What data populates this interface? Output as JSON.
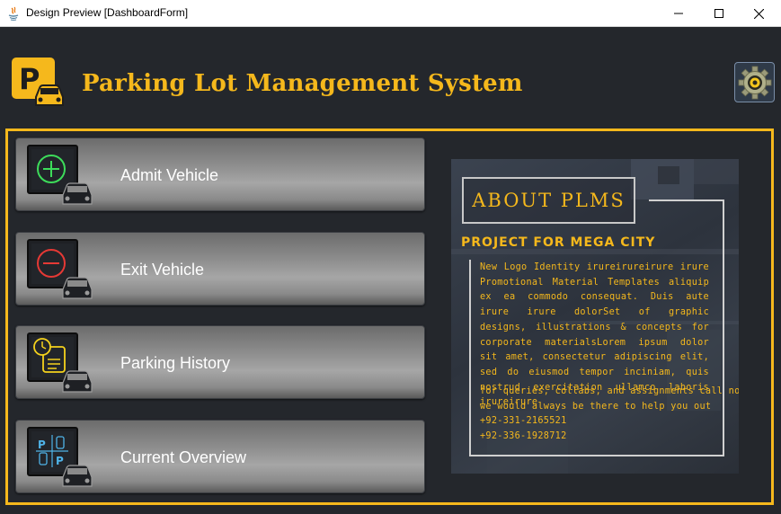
{
  "window": {
    "title": "Design Preview [DashboardForm]",
    "controls": [
      "minimize",
      "maximize",
      "close"
    ]
  },
  "header": {
    "logo_letter": "P",
    "title": "Parking Lot Management System",
    "settings_icon": "gear-icon"
  },
  "menu": [
    {
      "label": "Admit Vehicle",
      "icon": "admit-vehicle-icon"
    },
    {
      "label": "Exit Vehicle",
      "icon": "exit-vehicle-icon"
    },
    {
      "label": "Parking History",
      "icon": "parking-history-icon"
    },
    {
      "label": "Current Overview",
      "icon": "current-overview-icon"
    }
  ],
  "about": {
    "heading": "ABOUT PLMS",
    "subheading": "PROJECT FOR MEGA CITY",
    "body": "New Logo Identity irureirureirure irure Promotional Material Templates aliquip ex ea commodo consequat. Duis aute irure irure dolorSet of graphic designs, illustrations & concepts for corporate materialsLorem ipsum dolor sit amet, consectetur adipiscing elit, sed do eiusmod tempor inciniam, quis nostrud exercitation ullamco laboris irureirure",
    "contact_line1": "for queries, collabs, and assignments call now",
    "contact_line2": "we would always be there to help you out",
    "phone1": "+92-331-2165521",
    "phone2": "+92-336-1928712"
  },
  "colors": {
    "accent": "#f5b81c",
    "background": "#24272c",
    "admit_icon": "#3ddc5a",
    "exit_icon": "#e53935",
    "history_icon": "#f5d21c",
    "overview_icon": "#4fb3e8"
  }
}
